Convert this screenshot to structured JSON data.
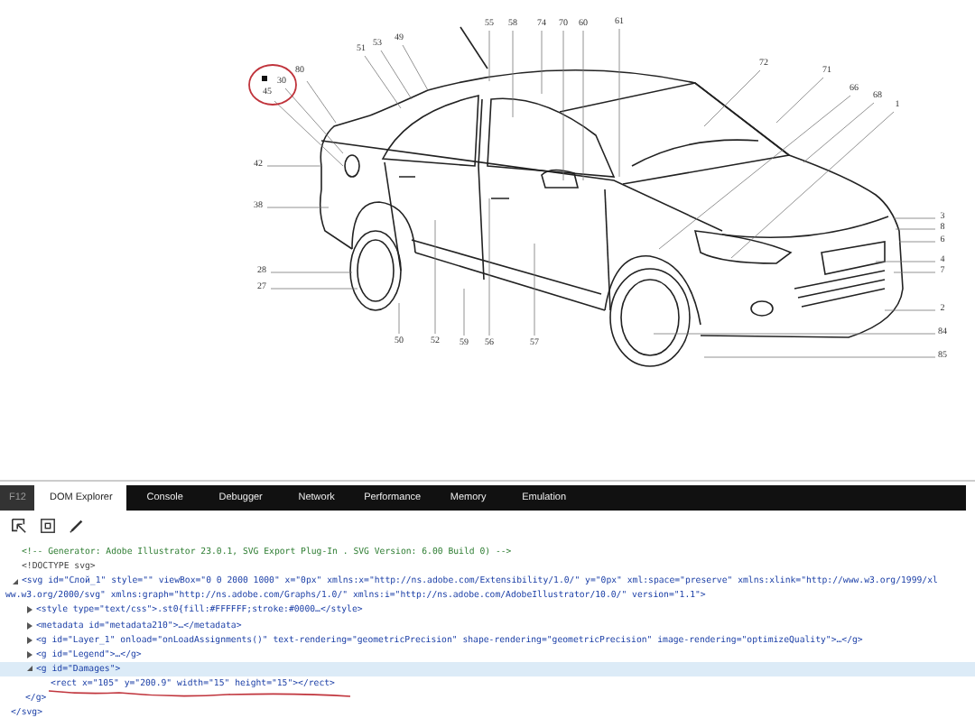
{
  "diagram": {
    "callouts": [
      "55",
      "58",
      "74",
      "70",
      "60",
      "61",
      "49",
      "53",
      "51",
      "80",
      "30",
      "45",
      "72",
      "71",
      "66",
      "68",
      "1",
      "42",
      "38",
      "28",
      "27",
      "3",
      "8",
      "6",
      "4",
      "7",
      "2",
      "84",
      "85",
      "50",
      "52",
      "59",
      "56",
      "57"
    ]
  },
  "devtools": {
    "tabs": [
      {
        "label": "F12",
        "kind": "key",
        "selected": false
      },
      {
        "label": "DOM Explorer",
        "kind": "tab",
        "selected": true
      },
      {
        "label": "Console",
        "kind": "tab",
        "selected": false
      },
      {
        "label": "Debugger",
        "kind": "tab",
        "selected": false
      },
      {
        "label": "Network",
        "kind": "tab",
        "selected": false
      },
      {
        "label": "Performance",
        "kind": "tab",
        "selected": false
      },
      {
        "label": "Memory",
        "kind": "tab",
        "selected": false
      },
      {
        "label": "Emulation",
        "kind": "tab",
        "selected": false
      }
    ],
    "dom_tree": [
      {
        "kind": "comment",
        "text": "<!-- Generator: Adobe Illustrator 23.0.1, SVG Export Plug-In . SVG Version: 6.00 Build 0) -->",
        "selected": false
      },
      {
        "kind": "doctype",
        "text": "<!DOCTYPE svg>",
        "selected": false
      },
      {
        "kind": "element",
        "text": "<svg id=\"Слой_1\" style=\"\" viewBox=\"0 0 2000 1000\" x=\"0px\" xmlns:x=\"http://ns.adobe.com/Extensibility/1.0/\" y=\"0px\" xml:space=\"preserve\" xmlns:xlink=\"http://www.w3.org/1999/xl",
        "text_continued": "ww.w3.org/2000/svg\" xmlns:graph=\"http://ns.adobe.com/Graphs/1.0/\" xmlns:i=\"http://ns.adobe.com/AdobeIllustrator/10.0/\" version=\"1.1\">",
        "expanded": true,
        "selected": false,
        "closing": "</svg>",
        "children": [
          {
            "kind": "element",
            "text": "<style type=\"text/css\">.st0{fill:#FFFFFF;stroke:#0000…</style>",
            "expanded": false,
            "selected": false
          },
          {
            "kind": "element",
            "text": "<metadata id=\"metadata210\">…</metadata>",
            "expanded": false,
            "selected": false
          },
          {
            "kind": "element",
            "text": "<g id=\"Layer_1\" onload=\"onLoadAssignments()\" text-rendering=\"geometricPrecision\" shape-rendering=\"geometricPrecision\" image-rendering=\"optimizeQuality\">…</g>",
            "expanded": false,
            "selected": false
          },
          {
            "kind": "element",
            "text": "<g id=\"Legend\">…</g>",
            "expanded": false,
            "selected": false
          },
          {
            "kind": "element",
            "text": "<g id=\"Damages\">",
            "expanded": true,
            "selected": true,
            "closing": "</g>",
            "children": [
              {
                "kind": "element",
                "text": "<rect x=\"105\" y=\"200.9\" width=\"15\" height=\"15\"></rect>",
                "selected": false
              }
            ]
          }
        ]
      }
    ]
  }
}
